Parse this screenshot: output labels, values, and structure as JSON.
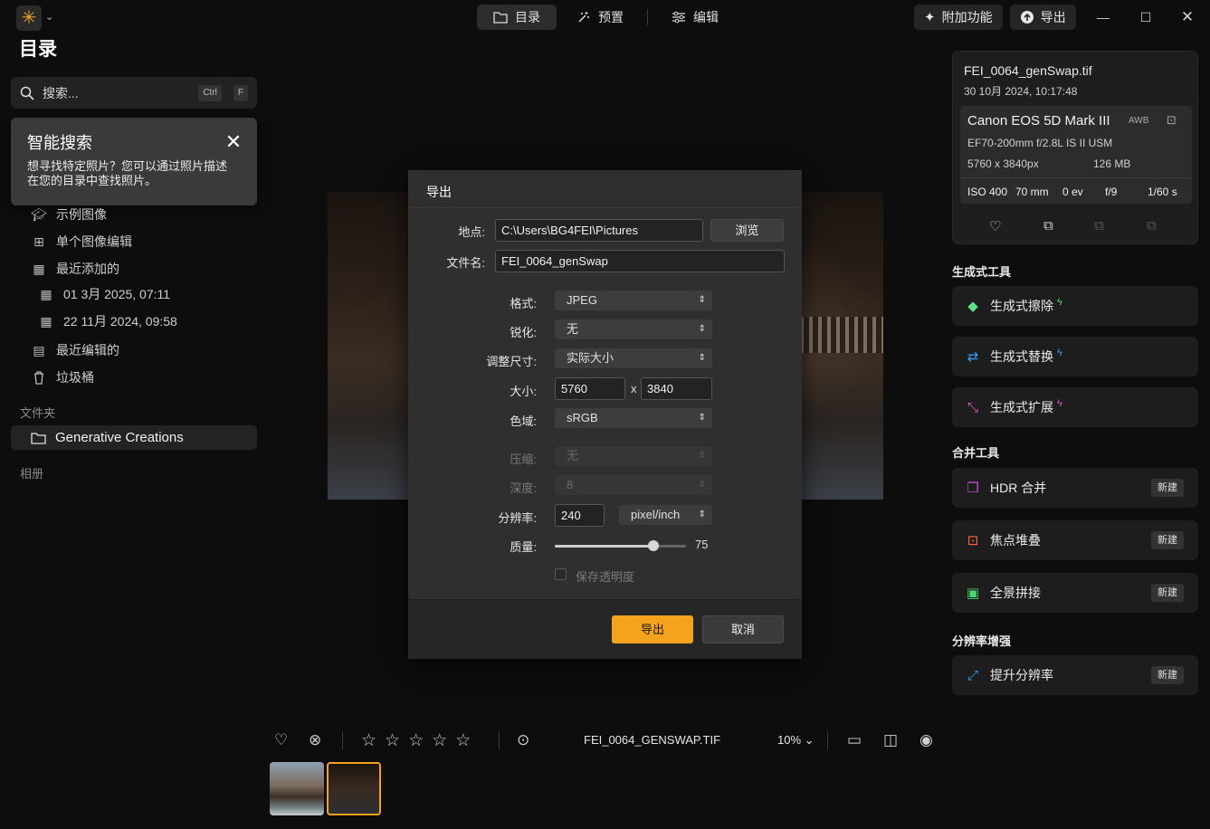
{
  "topbar": {
    "logo_glyph": "✳",
    "nav": [
      {
        "label": "目录",
        "icon": "folder-icon",
        "active": true
      },
      {
        "label": "预置",
        "icon": "magic-wand-icon",
        "active": false
      },
      {
        "label": "编辑",
        "icon": "sliders-icon",
        "active": false
      }
    ],
    "addons_label": "附加功能",
    "export_label": "导出"
  },
  "sidebar": {
    "title": "目录",
    "search_placeholder": "搜索...",
    "search_shortcut": [
      "Ctrl",
      "F"
    ],
    "tip": {
      "title": "智能搜索",
      "body": "想寻找特定照片？您可以通过照片描述在您的目录中查找照片。"
    },
    "items": [
      {
        "label": "示例图像",
        "icon": "graduation-cap-icon"
      },
      {
        "label": "单个图像编辑",
        "icon": "grid-icon"
      },
      {
        "label": "最近添加的",
        "icon": "calendar-icon"
      },
      {
        "label": "01 3月 2025, 07:11",
        "icon": "calendar-icon"
      },
      {
        "label": "22 11月 2024, 09:58",
        "icon": "calendar-icon"
      },
      {
        "label": "最近编辑的",
        "icon": "calendar-edit-icon"
      },
      {
        "label": "垃圾桶",
        "icon": "trash-icon"
      }
    ],
    "folders_label": "文件夹",
    "folder": "Generative Creations",
    "albums_label": "相册"
  },
  "dialog": {
    "title": "导出",
    "location_label": "地点:",
    "location_value": "C:\\Users\\BG4FEI\\Pictures",
    "browse_label": "浏览",
    "filename_label": "文件名:",
    "filename_value": "FEI_0064_genSwap",
    "format_label": "格式:",
    "format_value": "JPEG",
    "sharpen_label": "锐化:",
    "sharpen_value": "无",
    "resize_label": "调整尺寸:",
    "resize_value": "实际大小",
    "size_label": "大小:",
    "width": "5760",
    "times": "x",
    "height": "3840",
    "colorspace_label": "色域:",
    "colorspace_value": "sRGB",
    "compression_label": "压缩:",
    "compression_value": "无",
    "depth_label": "深度:",
    "depth_value": "8",
    "resolution_label": "分辨率:",
    "resolution_value": "240",
    "resolution_unit": "pixel/inch",
    "quality_label": "质量:",
    "quality_value": "75",
    "quality_max": 100,
    "keep_transparency_label": "保存透明度",
    "export_button": "导出",
    "cancel_button": "取消",
    "accent_color": "#f5a21e"
  },
  "info": {
    "filename": "FEI_0064_genSwap.tif",
    "date": "30 10月 2024, 10:17:48",
    "camera": "Canon EOS 5D Mark III",
    "awb": "AWB",
    "lens": "EF70-200mm f/2.8L IS II USM",
    "dimensions": "5760 x 3840px",
    "filesize": "126 MB",
    "iso": "ISO 400",
    "focal": "70 mm",
    "ev": "0 ev",
    "aperture": "f/9",
    "shutter": "1/60 s"
  },
  "right_panel": {
    "gen_tools_label": "生成式工具",
    "gen_tools": [
      {
        "label": "生成式擦除",
        "icon": "eraser-icon",
        "color": "#5ee08a"
      },
      {
        "label": "生成式替换",
        "icon": "replace-icon",
        "color": "#3aa0ff"
      },
      {
        "label": "生成式扩展",
        "icon": "expand-icon",
        "color": "#e056c8"
      }
    ],
    "merge_tools_label": "合并工具",
    "merge_tools": [
      {
        "label": "HDR 合并",
        "icon": "hdr-icon",
        "color": "#c24ed8",
        "badge": "新建"
      },
      {
        "label": "焦点堆叠",
        "icon": "focus-icon",
        "color": "#ff6a3d",
        "badge": "新建"
      },
      {
        "label": "全景拼接",
        "icon": "panorama-icon",
        "color": "#4ad66d",
        "badge": "新建"
      }
    ],
    "resolution_label": "分辨率增强",
    "resolution_tool": {
      "label": "提升分辨率",
      "icon": "upscale-icon",
      "color": "#2d9cf0",
      "badge": "新建"
    }
  },
  "bottombar": {
    "filename": "FEI_0064_GENSWAP.TIF",
    "zoom": "10%",
    "rating": 0,
    "zoom_chevron": "⌄"
  }
}
